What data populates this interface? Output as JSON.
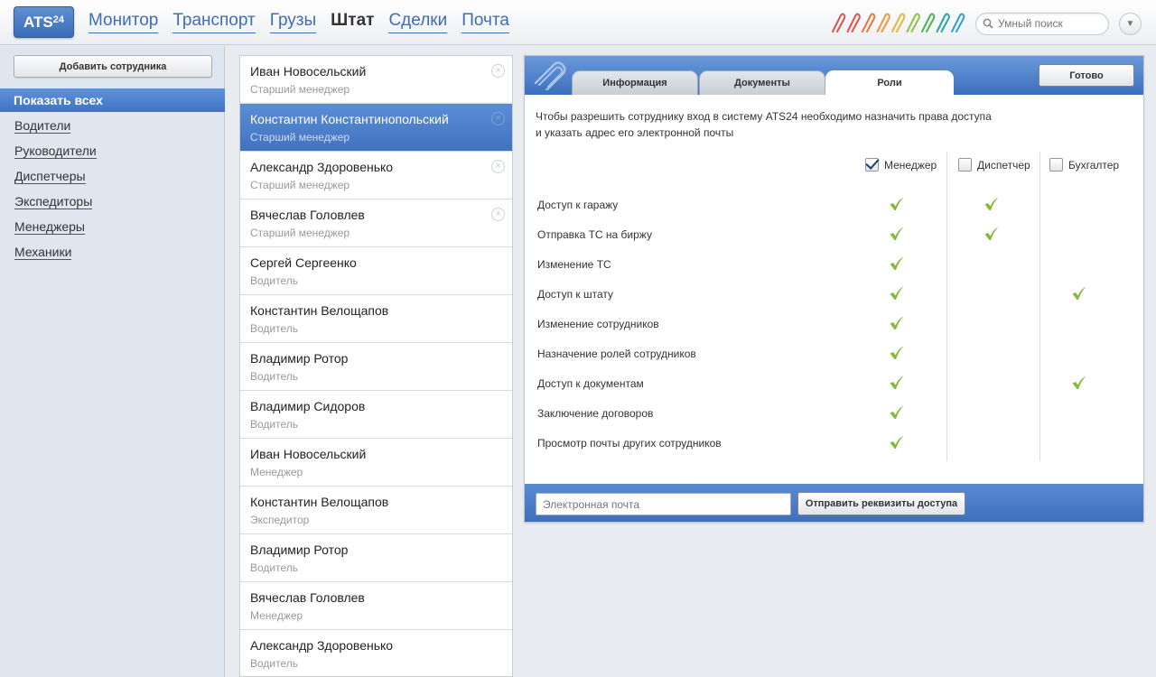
{
  "app": {
    "logo_text": "ATS",
    "logo_sup": "24"
  },
  "nav": [
    {
      "label": "Монитор",
      "active": false
    },
    {
      "label": "Транспорт",
      "active": false
    },
    {
      "label": "Грузы",
      "active": false
    },
    {
      "label": "Штат",
      "active": true
    },
    {
      "label": "Сделки",
      "active": false
    },
    {
      "label": "Почта",
      "active": false
    }
  ],
  "clip_colors": [
    "#d9534f",
    "#e0524a",
    "#e8763a",
    "#ec9a3a",
    "#e9b43c",
    "#8cc33f",
    "#4fb24f",
    "#27a6a0",
    "#2f9fd0"
  ],
  "search": {
    "placeholder": "Умный поиск",
    "icon": "search-icon"
  },
  "sidebar": {
    "add_button": "Добавить сотрудника",
    "show_all": "Показать всех",
    "filters": [
      "Водители",
      "Руководители",
      "Диспетчеры",
      "Экспедиторы",
      "Менеджеры",
      "Механики"
    ]
  },
  "employees": [
    {
      "name": "Иван Новосельский",
      "role": "Старший менеджер",
      "selected": false,
      "removable": true
    },
    {
      "name": "Константин Константинопольский",
      "role": "Старший менеджер",
      "selected": true,
      "removable": true
    },
    {
      "name": "Александр Здоровенько",
      "role": "Старший менеджер",
      "selected": false,
      "removable": true
    },
    {
      "name": "Вячеслав Головлев",
      "role": "Старший менеджер",
      "selected": false,
      "removable": true
    },
    {
      "name": "Сергей Сергеенко",
      "role": "Водитель",
      "selected": false,
      "removable": false
    },
    {
      "name": "Константин Велощапов",
      "role": "Водитель",
      "selected": false,
      "removable": false
    },
    {
      "name": "Владимир Ротор",
      "role": "Водитель",
      "selected": false,
      "removable": false
    },
    {
      "name": "Владимир Сидоров",
      "role": "Водитель",
      "selected": false,
      "removable": false
    },
    {
      "name": "Иван Новосельский",
      "role": "Менеджер",
      "selected": false,
      "removable": false
    },
    {
      "name": "Константин Велощапов",
      "role": "Экспедитор",
      "selected": false,
      "removable": false
    },
    {
      "name": "Владимир Ротор",
      "role": "Водитель",
      "selected": false,
      "removable": false
    },
    {
      "name": "Вячеслав Головлев",
      "role": "Менеджер",
      "selected": false,
      "removable": false
    },
    {
      "name": "Александр Здоровенько",
      "role": "Водитель",
      "selected": false,
      "removable": false
    }
  ],
  "panel": {
    "tabs": [
      "Информация",
      "Документы",
      "Роли"
    ],
    "active_tab": "Роли",
    "done_button": "Готово",
    "intro_line1": "Чтобы разрешить сотруднику вход в систему ATS24 необходимо назначить права доступа",
    "intro_line2": "и указать адрес его электронной почты",
    "roles": [
      {
        "label": "Менеджер",
        "checked": true
      },
      {
        "label": "Диспетчер",
        "checked": false
      },
      {
        "label": "Бухгалтер",
        "checked": false
      }
    ],
    "permissions": [
      {
        "label": "Доступ к гаражу",
        "grants": [
          true,
          true,
          false
        ]
      },
      {
        "label": "Отправка ТС на биржу",
        "grants": [
          true,
          true,
          false
        ]
      },
      {
        "label": "Изменение ТС",
        "grants": [
          true,
          false,
          false
        ]
      },
      {
        "label": "Доступ к штату",
        "grants": [
          true,
          false,
          true
        ]
      },
      {
        "label": "Изменение сотрудников",
        "grants": [
          true,
          false,
          false
        ]
      },
      {
        "label": "Назначение ролей сотрудников",
        "grants": [
          true,
          false,
          false
        ]
      },
      {
        "label": "Доступ к документам",
        "grants": [
          true,
          false,
          true
        ]
      },
      {
        "label": "Заключение договоров",
        "grants": [
          true,
          false,
          false
        ]
      },
      {
        "label": "Просмотр почты других сотрудников",
        "grants": [
          true,
          false,
          false
        ]
      }
    ],
    "email_placeholder": "Электронная почта",
    "send_button": "Отправить реквизиты доступа",
    "tick_color": "#86b83a"
  }
}
